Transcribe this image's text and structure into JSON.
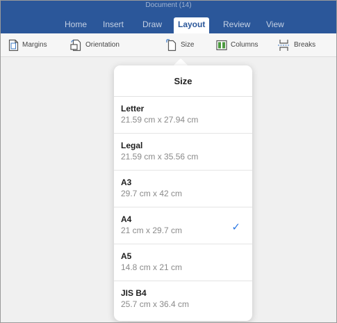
{
  "window": {
    "doc_title": "Document (14)"
  },
  "ribbon": {
    "tabs": [
      "Home",
      "Insert",
      "Draw",
      "Layout",
      "Review",
      "View"
    ],
    "active_tab": "Layout"
  },
  "toolbar": {
    "items": [
      {
        "label": "Margins",
        "icon": "margins-icon"
      },
      {
        "label": "Orientation",
        "icon": "orientation-icon"
      },
      {
        "label": "Size",
        "icon": "size-icon"
      },
      {
        "label": "Columns",
        "icon": "columns-icon"
      },
      {
        "label": "Breaks",
        "icon": "breaks-icon"
      }
    ]
  },
  "size_popover": {
    "title": "Size",
    "options": [
      {
        "name": "Letter",
        "dims": "21.59 cm x 27.94 cm",
        "selected": false
      },
      {
        "name": "Legal",
        "dims": "21.59 cm x 35.56 cm",
        "selected": false
      },
      {
        "name": "A3",
        "dims": "29.7 cm x 42 cm",
        "selected": false
      },
      {
        "name": "A4",
        "dims": "21 cm x 29.7 cm",
        "selected": true
      },
      {
        "name": "A5",
        "dims": "14.8 cm x 21 cm",
        "selected": false
      },
      {
        "name": "JIS B4",
        "dims": "25.7 cm x 36.4 cm",
        "selected": false
      }
    ],
    "check_glyph": "✓"
  },
  "colors": {
    "ribbon_blue": "#2b579a",
    "check_blue": "#2b78e4",
    "columns_green": "#4c9a3f"
  }
}
